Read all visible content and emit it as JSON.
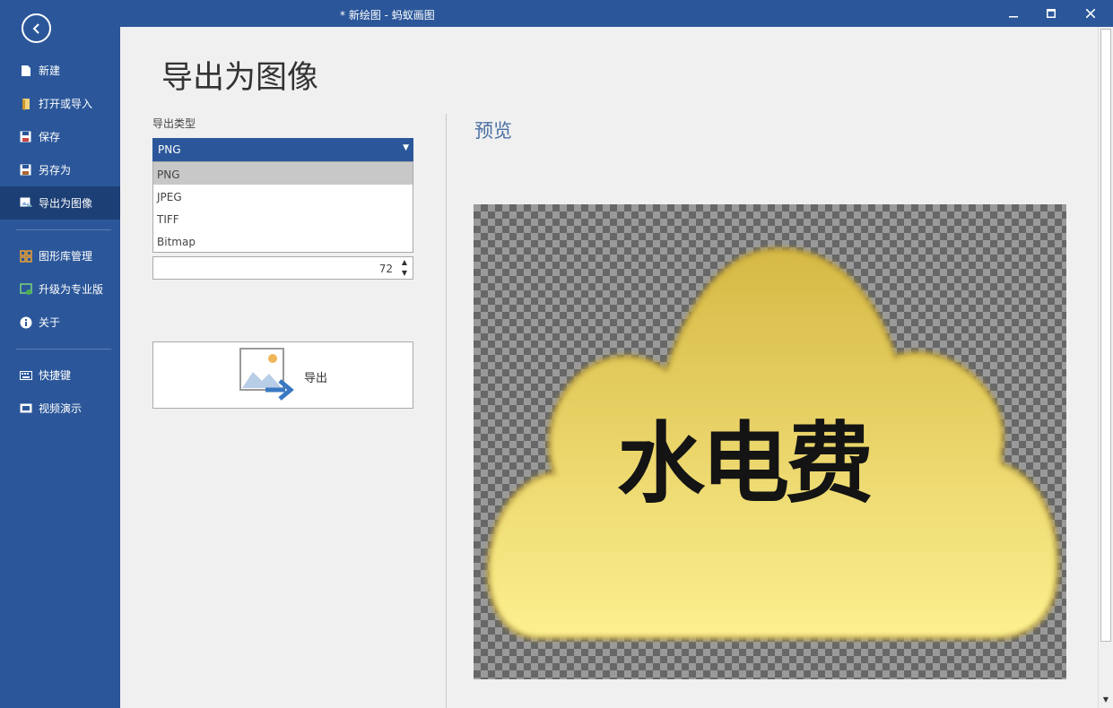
{
  "window": {
    "title": "* 新绘图 - 蚂蚁画图",
    "minimize": "—",
    "maximize": "☐",
    "close": "✕"
  },
  "sidebar": {
    "back_icon": "‹",
    "items": [
      {
        "label": "新建",
        "icon": "new-file-icon",
        "glyph": "▮"
      },
      {
        "label": "打开或导入",
        "icon": "folder-open-icon",
        "glyph": "▮"
      },
      {
        "label": "保存",
        "icon": "save-icon",
        "glyph": "▣"
      },
      {
        "label": "另存为",
        "icon": "save-as-icon",
        "glyph": "▣"
      },
      {
        "label": "导出为图像",
        "icon": "export-image-icon",
        "glyph": "▨"
      },
      {
        "label": "图形库管理",
        "icon": "shape-library-icon",
        "glyph": "▦"
      },
      {
        "label": "升级为专业版",
        "icon": "upgrade-icon",
        "glyph": "▩"
      },
      {
        "label": "关于",
        "icon": "info-icon",
        "glyph": "i"
      },
      {
        "label": "快捷键",
        "icon": "keyboard-icon",
        "glyph": "▤"
      },
      {
        "label": "视频演示",
        "icon": "video-icon",
        "glyph": "▭"
      }
    ],
    "active_index": 4
  },
  "main": {
    "title": "导出为图像",
    "export_type_label": "导出类型",
    "selected_type": "PNG",
    "dropdown_arrow": "▼",
    "options": [
      "PNG",
      "JPEG",
      "TIFF",
      "Bitmap"
    ],
    "dpi_value": "72",
    "spin_up": "▲",
    "spin_down": "▼",
    "export_label": "导出",
    "preview_title": "预览",
    "preview_text": "水电费"
  },
  "colors": {
    "brand": "#2b579a",
    "brand_dark": "#1c3f75",
    "cloud_top": "#d6b945",
    "cloud_bottom": "#fdf08f",
    "preview_title": "#4a6fa5"
  }
}
